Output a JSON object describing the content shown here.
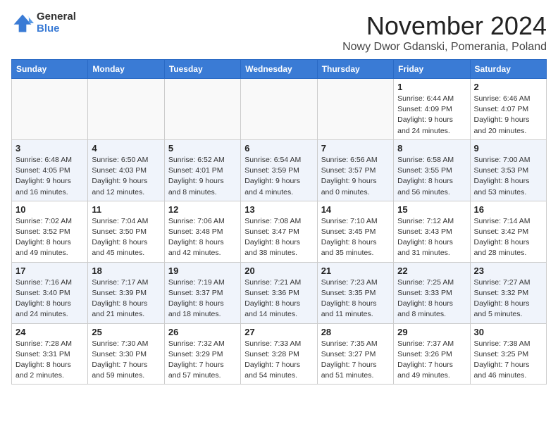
{
  "logo": {
    "general": "General",
    "blue": "Blue"
  },
  "title": "November 2024",
  "subtitle": "Nowy Dwor Gdanski, Pomerania, Poland",
  "days_header": [
    "Sunday",
    "Monday",
    "Tuesday",
    "Wednesday",
    "Thursday",
    "Friday",
    "Saturday"
  ],
  "weeks": [
    [
      {
        "day": "",
        "info": ""
      },
      {
        "day": "",
        "info": ""
      },
      {
        "day": "",
        "info": ""
      },
      {
        "day": "",
        "info": ""
      },
      {
        "day": "",
        "info": ""
      },
      {
        "day": "1",
        "info": "Sunrise: 6:44 AM\nSunset: 4:09 PM\nDaylight: 9 hours and 24 minutes."
      },
      {
        "day": "2",
        "info": "Sunrise: 6:46 AM\nSunset: 4:07 PM\nDaylight: 9 hours and 20 minutes."
      }
    ],
    [
      {
        "day": "3",
        "info": "Sunrise: 6:48 AM\nSunset: 4:05 PM\nDaylight: 9 hours and 16 minutes."
      },
      {
        "day": "4",
        "info": "Sunrise: 6:50 AM\nSunset: 4:03 PM\nDaylight: 9 hours and 12 minutes."
      },
      {
        "day": "5",
        "info": "Sunrise: 6:52 AM\nSunset: 4:01 PM\nDaylight: 9 hours and 8 minutes."
      },
      {
        "day": "6",
        "info": "Sunrise: 6:54 AM\nSunset: 3:59 PM\nDaylight: 9 hours and 4 minutes."
      },
      {
        "day": "7",
        "info": "Sunrise: 6:56 AM\nSunset: 3:57 PM\nDaylight: 9 hours and 0 minutes."
      },
      {
        "day": "8",
        "info": "Sunrise: 6:58 AM\nSunset: 3:55 PM\nDaylight: 8 hours and 56 minutes."
      },
      {
        "day": "9",
        "info": "Sunrise: 7:00 AM\nSunset: 3:53 PM\nDaylight: 8 hours and 53 minutes."
      }
    ],
    [
      {
        "day": "10",
        "info": "Sunrise: 7:02 AM\nSunset: 3:52 PM\nDaylight: 8 hours and 49 minutes."
      },
      {
        "day": "11",
        "info": "Sunrise: 7:04 AM\nSunset: 3:50 PM\nDaylight: 8 hours and 45 minutes."
      },
      {
        "day": "12",
        "info": "Sunrise: 7:06 AM\nSunset: 3:48 PM\nDaylight: 8 hours and 42 minutes."
      },
      {
        "day": "13",
        "info": "Sunrise: 7:08 AM\nSunset: 3:47 PM\nDaylight: 8 hours and 38 minutes."
      },
      {
        "day": "14",
        "info": "Sunrise: 7:10 AM\nSunset: 3:45 PM\nDaylight: 8 hours and 35 minutes."
      },
      {
        "day": "15",
        "info": "Sunrise: 7:12 AM\nSunset: 3:43 PM\nDaylight: 8 hours and 31 minutes."
      },
      {
        "day": "16",
        "info": "Sunrise: 7:14 AM\nSunset: 3:42 PM\nDaylight: 8 hours and 28 minutes."
      }
    ],
    [
      {
        "day": "17",
        "info": "Sunrise: 7:16 AM\nSunset: 3:40 PM\nDaylight: 8 hours and 24 minutes."
      },
      {
        "day": "18",
        "info": "Sunrise: 7:17 AM\nSunset: 3:39 PM\nDaylight: 8 hours and 21 minutes."
      },
      {
        "day": "19",
        "info": "Sunrise: 7:19 AM\nSunset: 3:37 PM\nDaylight: 8 hours and 18 minutes."
      },
      {
        "day": "20",
        "info": "Sunrise: 7:21 AM\nSunset: 3:36 PM\nDaylight: 8 hours and 14 minutes."
      },
      {
        "day": "21",
        "info": "Sunrise: 7:23 AM\nSunset: 3:35 PM\nDaylight: 8 hours and 11 minutes."
      },
      {
        "day": "22",
        "info": "Sunrise: 7:25 AM\nSunset: 3:33 PM\nDaylight: 8 hours and 8 minutes."
      },
      {
        "day": "23",
        "info": "Sunrise: 7:27 AM\nSunset: 3:32 PM\nDaylight: 8 hours and 5 minutes."
      }
    ],
    [
      {
        "day": "24",
        "info": "Sunrise: 7:28 AM\nSunset: 3:31 PM\nDaylight: 8 hours and 2 minutes."
      },
      {
        "day": "25",
        "info": "Sunrise: 7:30 AM\nSunset: 3:30 PM\nDaylight: 7 hours and 59 minutes."
      },
      {
        "day": "26",
        "info": "Sunrise: 7:32 AM\nSunset: 3:29 PM\nDaylight: 7 hours and 57 minutes."
      },
      {
        "day": "27",
        "info": "Sunrise: 7:33 AM\nSunset: 3:28 PM\nDaylight: 7 hours and 54 minutes."
      },
      {
        "day": "28",
        "info": "Sunrise: 7:35 AM\nSunset: 3:27 PM\nDaylight: 7 hours and 51 minutes."
      },
      {
        "day": "29",
        "info": "Sunrise: 7:37 AM\nSunset: 3:26 PM\nDaylight: 7 hours and 49 minutes."
      },
      {
        "day": "30",
        "info": "Sunrise: 7:38 AM\nSunset: 3:25 PM\nDaylight: 7 hours and 46 minutes."
      }
    ]
  ]
}
